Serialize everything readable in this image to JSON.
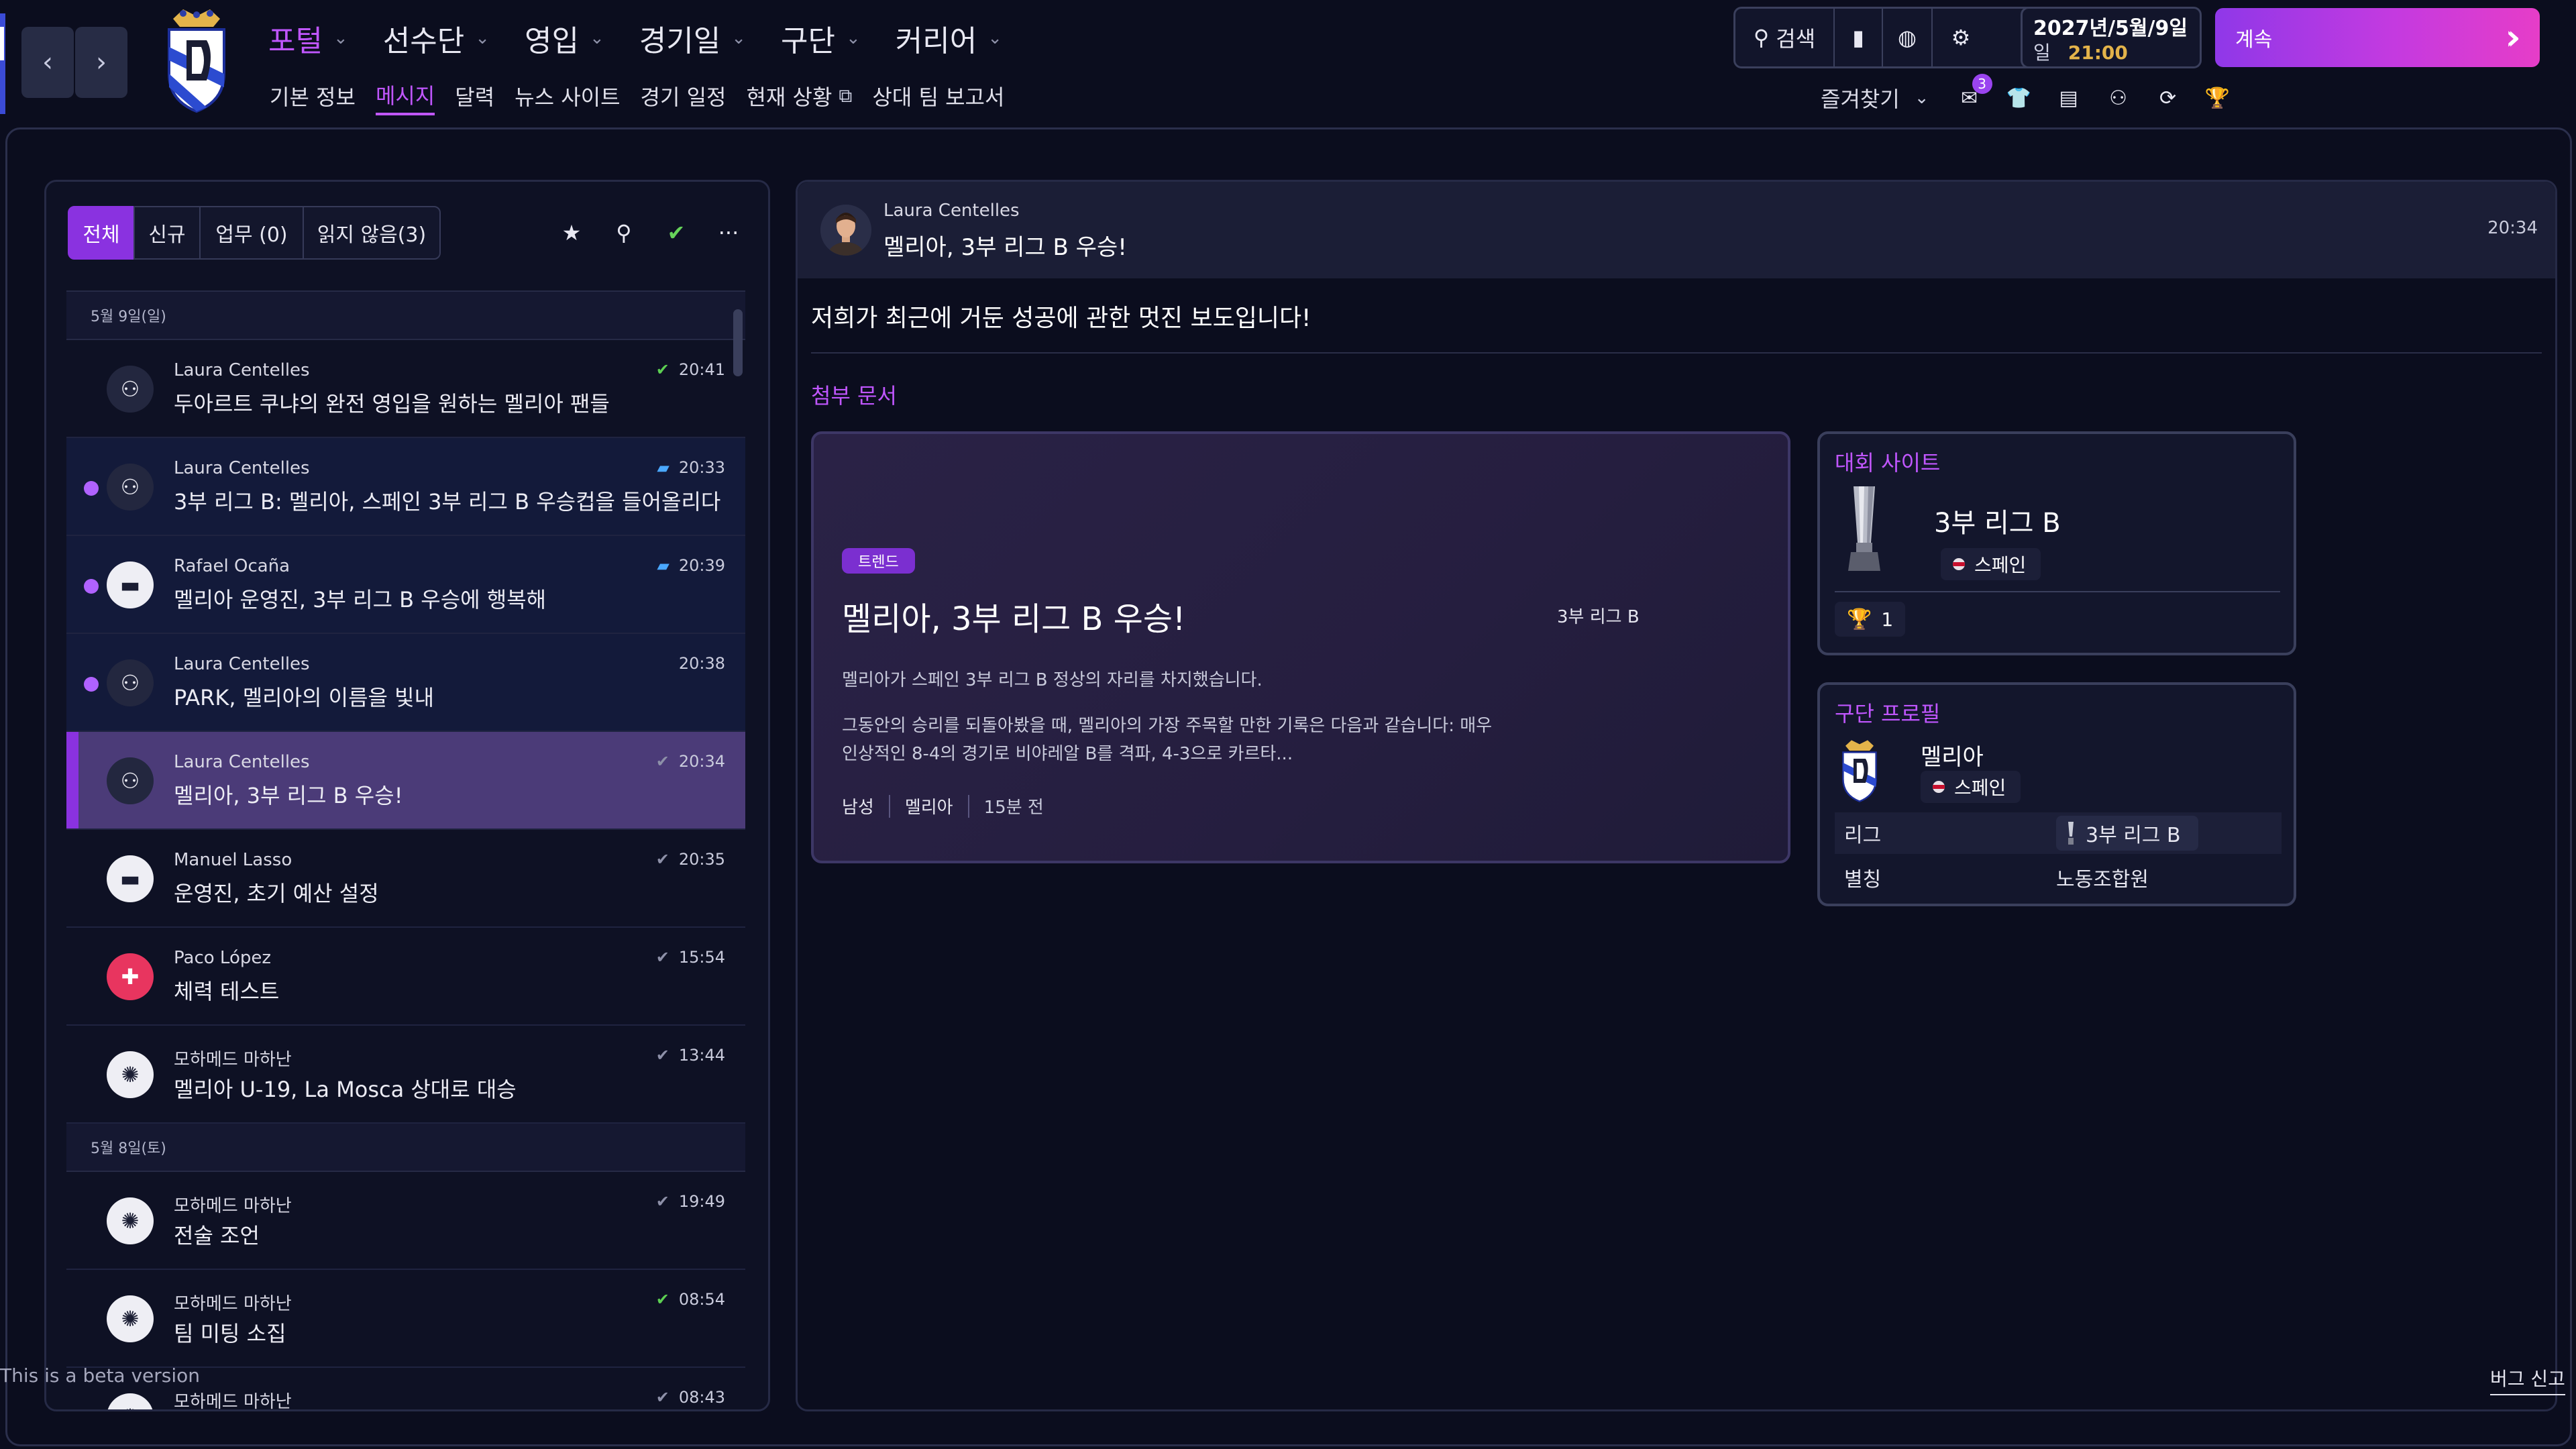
{
  "topnav": {
    "main_menu": [
      {
        "label": "포털",
        "active": true
      },
      {
        "label": "선수단",
        "active": false
      },
      {
        "label": "영입",
        "active": false
      },
      {
        "label": "경기일",
        "active": false
      },
      {
        "label": "구단",
        "active": false
      },
      {
        "label": "커리어",
        "active": false
      }
    ],
    "sub_menu": [
      {
        "label": "기본 정보",
        "active": false
      },
      {
        "label": "메시지",
        "active": true
      },
      {
        "label": "달력",
        "active": false
      },
      {
        "label": "뉴스 사이트",
        "active": false
      },
      {
        "label": "경기 일정",
        "active": false
      },
      {
        "label": "현재 상황",
        "active": false,
        "external": true
      },
      {
        "label": "상대 팀 보고서",
        "active": false
      }
    ],
    "search_label": "검색",
    "date_line1": "2027년/5월/9일",
    "date_weekday": "일",
    "time": "21:00",
    "continue_label": "계속",
    "favorites_label": "즐겨찾기",
    "notification_count": "3",
    "accent_color": "#c056ff"
  },
  "inbox": {
    "filters": [
      {
        "label": "전체",
        "active": true
      },
      {
        "label": "신규",
        "active": false
      },
      {
        "label": "업무 (0)",
        "active": false
      },
      {
        "label": "읽지 않음(3)",
        "active": false
      }
    ],
    "groups": [
      {
        "date": "5월 9일(일)",
        "messages": [
          {
            "sender": "Laura Centelles",
            "subject": "두아르트 쿠냐의 완전 영입을 원하는 멜리아 팬들",
            "time": "20:41",
            "status": "read-green",
            "icon": "journalist-icon",
            "unread": false,
            "selected": false
          },
          {
            "sender": "Laura Centelles",
            "subject": "3부 리그 B: 멜리아, 스페인 3부 리그 B 우승컵을 들어올리다",
            "time": "20:33",
            "status": "comment",
            "icon": "journalist-icon",
            "unread": true,
            "selected": false
          },
          {
            "sender": "Rafael Ocaña",
            "subject": "멜리아 운영진, 3부 리그 B 우승에 행복해",
            "time": "20:39",
            "status": "comment",
            "icon": "briefcase-icon",
            "unread": true,
            "selected": false
          },
          {
            "sender": "Laura Centelles",
            "subject": "PARK, 멜리아의 이름을 빛내",
            "time": "20:38",
            "status": "none",
            "icon": "journalist-icon",
            "unread": true,
            "selected": false
          },
          {
            "sender": "Laura Centelles",
            "subject": "멜리아, 3부 리그 B 우승!",
            "time": "20:34",
            "status": "read",
            "icon": "journalist-icon",
            "unread": false,
            "selected": true
          },
          {
            "sender": "Manuel Lasso",
            "subject": "운영진, 초기 예산 설정",
            "time": "20:35",
            "status": "read",
            "icon": "briefcase-icon",
            "unread": false,
            "selected": false
          },
          {
            "sender": "Paco López",
            "subject": "체력 테스트",
            "time": "15:54",
            "status": "read",
            "icon": "medical-icon",
            "unread": false,
            "selected": false
          },
          {
            "sender": "모하메드 마하난",
            "subject": "멜리아 U-19, La Mosca 상대로 대승",
            "time": "13:44",
            "status": "read",
            "icon": "staff-group-icon",
            "unread": false,
            "selected": false
          }
        ]
      },
      {
        "date": "5월 8일(토)",
        "messages": [
          {
            "sender": "모하메드 마하난",
            "subject": "전술 조언",
            "time": "19:49",
            "status": "read",
            "icon": "staff-group-icon",
            "unread": false,
            "selected": false
          },
          {
            "sender": "모하메드 마하난",
            "subject": "팀 미팅 소집",
            "time": "08:54",
            "status": "read-green",
            "icon": "staff-group-icon",
            "unread": false,
            "selected": false
          },
          {
            "sender": "모하메드 마하난",
            "subject": "",
            "time": "08:43",
            "status": "read",
            "icon": "staff-group-icon",
            "unread": false,
            "selected": false
          }
        ]
      }
    ]
  },
  "message": {
    "from": "Laura Centelles",
    "subject": "멜리아, 3부 리그 B 우승!",
    "time": "20:34",
    "body": "저희가 최근에 거둔 성공에 관한 멋진 보도입니다!",
    "attachments_title": "첨부 문서",
    "news": {
      "tag": "트렌드",
      "title": "멜리아, 3부 리그 B 우승!",
      "side_label": "3부 리그 B",
      "para1": "멜리아가 스페인 3부 리그 B 정상의 자리를 차지했습니다.",
      "para2": "그동안의 승리를 되돌아봤을 때, 멜리아의 가장 주목할 만한 기록은 다음과 같습니다: 매우 인상적인 8-4의 경기로 비야레알 B를 격파, 4-3으로 카르타...",
      "tags": [
        "남성",
        "멜리아",
        "15분 전"
      ]
    },
    "competition_card": {
      "title": "대회 사이트",
      "name": "3부 리그 B",
      "nation": "스페인",
      "titles_count": "1"
    },
    "club_card": {
      "title": "구단 프로필",
      "name": "멜리아",
      "nation": "스페인",
      "league_label": "리그",
      "league_value": "3부 리그 B",
      "nickname_label": "별칭",
      "nickname_value": "노동조합원"
    }
  },
  "footer": {
    "beta": "This is a beta version",
    "bug_report": "버그 신고"
  }
}
